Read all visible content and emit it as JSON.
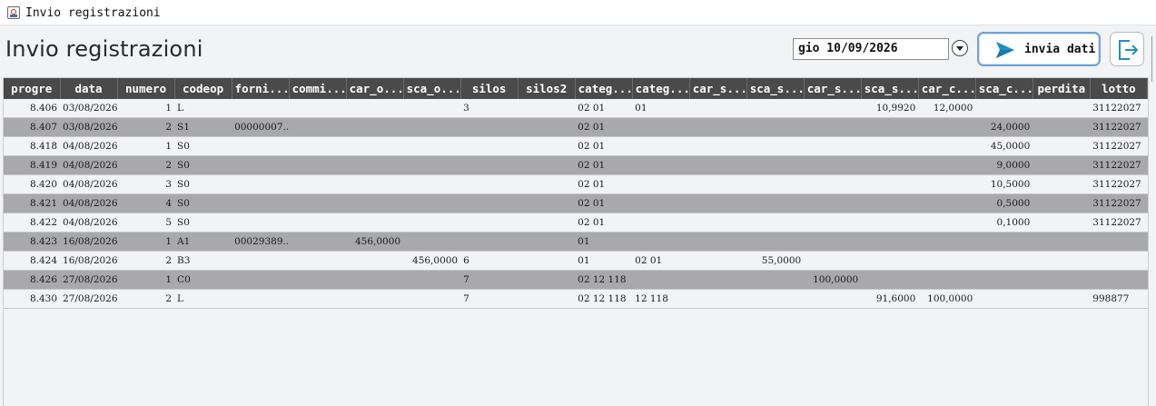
{
  "window": {
    "title": "Invio registrazioni"
  },
  "header": {
    "page_title": "Invio registrazioni",
    "date_value": "gio 10/09/2026",
    "send_label": "invia dati",
    "send_icon": "paper-plane-icon",
    "exit_icon": "exit-icon"
  },
  "colors": {
    "header_bg": "#4a4a4a",
    "row_alt_bg": "#a9a9ab",
    "accent": "#1e8fc4",
    "button_border": "#6ea4d6"
  },
  "table": {
    "columns": [
      "progre",
      "data",
      "numero",
      "codeop",
      "forni...",
      "commi...",
      "car_o...",
      "sca_o...",
      "silos",
      "silos2",
      "categ...",
      "categ...",
      "car_s...",
      "sca_s...",
      "car_s...",
      "sca_s...",
      "car_c...",
      "sca_c...",
      "perdita",
      "lotto"
    ],
    "rows": [
      [
        "8.406",
        "03/08/2026",
        "1",
        "L",
        "",
        "",
        "",
        "",
        "3",
        "",
        "02 01",
        "01",
        "",
        "",
        "",
        "10,9920",
        "12,0000",
        "",
        "",
        "31122027"
      ],
      [
        "8.407",
        "03/08/2026",
        "2",
        "S1",
        "00000007...",
        "",
        "",
        "",
        "",
        "",
        "02 01",
        "",
        "",
        "",
        "",
        "",
        "",
        "24,0000",
        "",
        "31122027"
      ],
      [
        "8.418",
        "04/08/2026",
        "1",
        "S0",
        "",
        "",
        "",
        "",
        "",
        "",
        "02 01",
        "",
        "",
        "",
        "",
        "",
        "",
        "45,0000",
        "",
        "31122027"
      ],
      [
        "8.419",
        "04/08/2026",
        "2",
        "S0",
        "",
        "",
        "",
        "",
        "",
        "",
        "02 01",
        "",
        "",
        "",
        "",
        "",
        "",
        "9,0000",
        "",
        "31122027"
      ],
      [
        "8.420",
        "04/08/2026",
        "3",
        "S0",
        "",
        "",
        "",
        "",
        "",
        "",
        "02 01",
        "",
        "",
        "",
        "",
        "",
        "",
        "10,5000",
        "",
        "31122027"
      ],
      [
        "8.421",
        "04/08/2026",
        "4",
        "S0",
        "",
        "",
        "",
        "",
        "",
        "",
        "02 01",
        "",
        "",
        "",
        "",
        "",
        "",
        "0,5000",
        "",
        "31122027"
      ],
      [
        "8.422",
        "04/08/2026",
        "5",
        "S0",
        "",
        "",
        "",
        "",
        "",
        "",
        "02 01",
        "",
        "",
        "",
        "",
        "",
        "",
        "0,1000",
        "",
        "31122027"
      ],
      [
        "8.423",
        "16/08/2026",
        "1",
        "A1",
        "00029389...",
        "",
        "456,0000",
        "",
        "",
        "",
        "01",
        "",
        "",
        "",
        "",
        "",
        "",
        "",
        "",
        ""
      ],
      [
        "8.424",
        "16/08/2026",
        "2",
        "B3",
        "",
        "",
        "",
        "456,0000",
        "6",
        "",
        "01",
        "02 01",
        "",
        "55,0000",
        "",
        "",
        "",
        "",
        "",
        ""
      ],
      [
        "8.426",
        "27/08/2026",
        "1",
        "C0",
        "",
        "",
        "",
        "",
        "7",
        "",
        "02 12 118",
        "",
        "",
        "",
        "100,0000",
        "",
        "",
        "",
        "",
        ""
      ],
      [
        "8.430",
        "27/08/2026",
        "2",
        "L",
        "",
        "",
        "",
        "",
        "7",
        "",
        "02 12 118",
        "12 118",
        "",
        "",
        "",
        "91,6000",
        "100,0000",
        "",
        "",
        "998877"
      ]
    ]
  }
}
